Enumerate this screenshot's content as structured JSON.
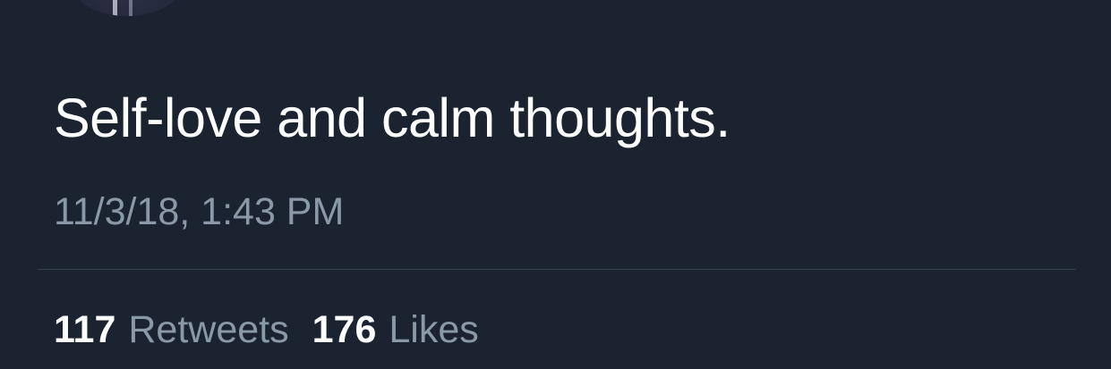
{
  "tweet": {
    "text": "Self-love and calm thoughts.",
    "timestamp": "11/3/18, 1:43 PM"
  },
  "stats": {
    "retweets": {
      "count": "117",
      "label": "Retweets"
    },
    "likes": {
      "count": "176",
      "label": "Likes"
    }
  },
  "colors": {
    "background": "#1b2330",
    "primary_text": "#ffffff",
    "secondary_text": "#8a99a8",
    "divider": "#38414f"
  }
}
